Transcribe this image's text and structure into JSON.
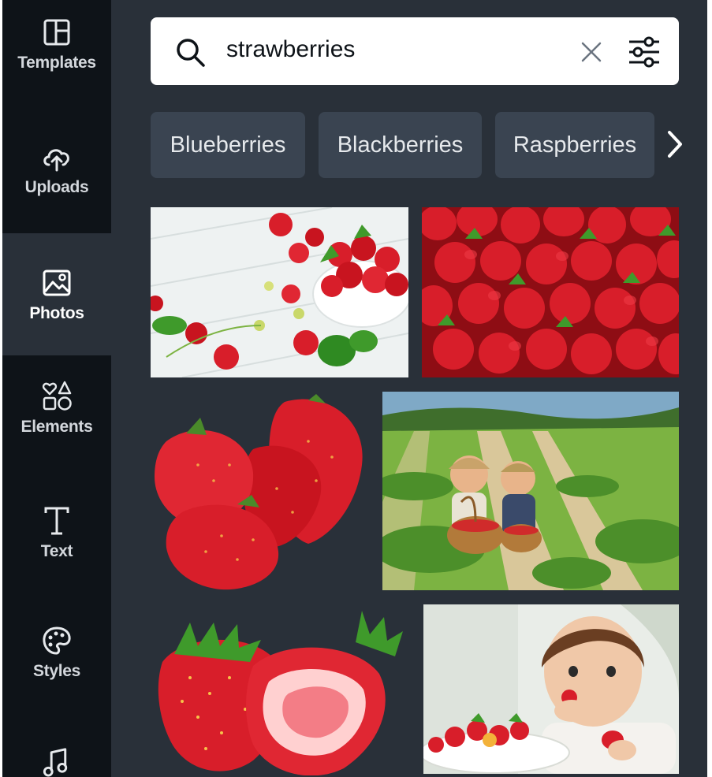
{
  "sidebar": {
    "items": [
      {
        "label": "Templates",
        "icon": "templates-icon"
      },
      {
        "label": "Uploads",
        "icon": "upload-cloud-icon"
      },
      {
        "label": "Photos",
        "icon": "photo-icon"
      },
      {
        "label": "Elements",
        "icon": "shapes-icon"
      },
      {
        "label": "Text",
        "icon": "text-icon"
      },
      {
        "label": "Styles",
        "icon": "palette-icon"
      },
      {
        "label": "",
        "icon": "music-note-icon"
      }
    ],
    "active": "Photos"
  },
  "search": {
    "value": "strawberries",
    "icons": [
      "search-icon",
      "clear-icon",
      "filter-sliders-icon"
    ]
  },
  "suggestions": {
    "chips": [
      "Blueberries",
      "Blackberries",
      "Raspberries"
    ],
    "more_icon": "chevron-right-icon"
  },
  "results": [
    {
      "subject": "strawberries in white bowl on white wood"
    },
    {
      "subject": "pile of strawberries"
    },
    {
      "subject": "three strawberries cutout"
    },
    {
      "subject": "children picking strawberries in field"
    },
    {
      "subject": "whole and halved strawberry cutout"
    },
    {
      "subject": "toddler eating strawberries"
    }
  ],
  "colors": {
    "sidebar_bg": "#0e1318",
    "panel_bg": "#293039",
    "chip_bg": "#3a4451",
    "active_bg": "#293039",
    "text_light": "#d3d7dc"
  }
}
